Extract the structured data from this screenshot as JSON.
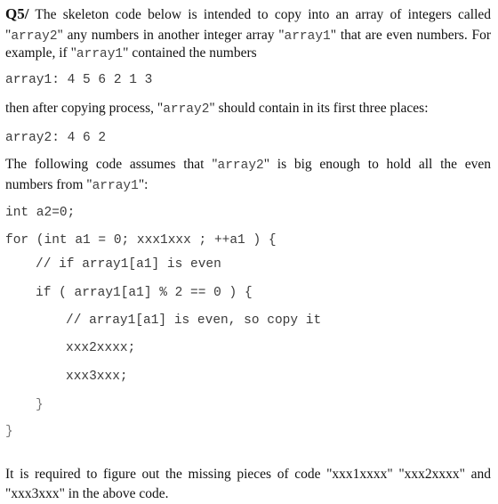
{
  "question": {
    "label": "Q5/",
    "intro": {
      "l1_rest": " The skeleton code below is intended to copy into an array of integers called",
      "l2_q1": "\"",
      "l2_a2": "array2",
      "l2_mid": "\" any numbers in another integer array \"",
      "l2_a1": "array1",
      "l2_end": "\" that are even numbers. For",
      "l3_pre": "example, if \"",
      "l3_a1": "array1",
      "l3_end": "\" contained the numbers"
    },
    "array1_line": "array1: 4 5 6 2 1 3",
    "then_pre": "then after copying process, \"",
    "then_a2": "array2",
    "then_end": "\" should contain in its first three places:",
    "array2_line": "array2: 4 6 2",
    "following": {
      "l1_pre": "The following code assumes that \"",
      "l1_a2": "array2",
      "l1_end": "\" is big enough to hold all the even",
      "l2_pre": "numbers from \"",
      "l2_a1": "array1",
      "l2_end": "\":"
    },
    "code": [
      "int a2=0;",
      "for (int a1 = 0; xxx1xxx ; ++a1 ) {",
      "// if array1[a1] is even",
      "if ( array1[a1] % 2 == 0 ) {",
      "// array1[a1] is even, so copy it",
      "xxx2xxxx;",
      "xxx3xxx;",
      "}",
      "}"
    ],
    "closing": {
      "l1": "It is required to figure out the missing pieces of code \"xxx1xxxx\" \"xxx2xxxx\" and",
      "l2": "\"xxx3xxx\" in the above code."
    }
  }
}
